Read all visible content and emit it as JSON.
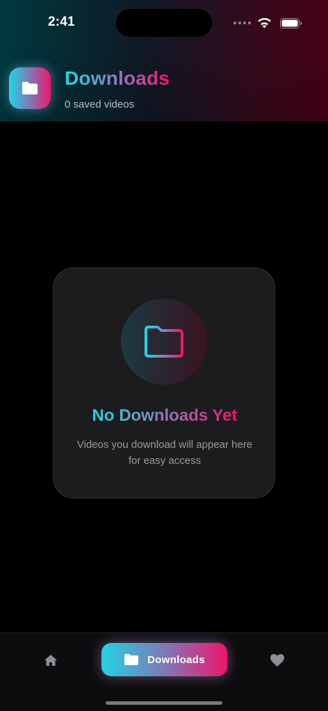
{
  "status_bar": {
    "time": "2:41"
  },
  "header": {
    "title": "Downloads",
    "subtitle": "0 saved videos",
    "icon": "folder-icon"
  },
  "empty_state": {
    "icon": "folder-icon",
    "title": "No Downloads Yet",
    "description": "Videos you download will appear here for easy access"
  },
  "bottom_nav": {
    "items": [
      {
        "id": "home",
        "icon": "home-icon",
        "label": "",
        "active": false
      },
      {
        "id": "downloads",
        "icon": "folder-icon",
        "label": "Downloads",
        "active": true
      },
      {
        "id": "favorites",
        "icon": "heart-icon",
        "label": "",
        "active": false
      }
    ]
  },
  "colors": {
    "gradient_start": "#22d3e6",
    "gradient_mid": "#8a6fb0",
    "gradient_end": "#f0146a",
    "background": "#000000",
    "card": "#1c1c1e",
    "nav_background": "#0d0d0f"
  }
}
